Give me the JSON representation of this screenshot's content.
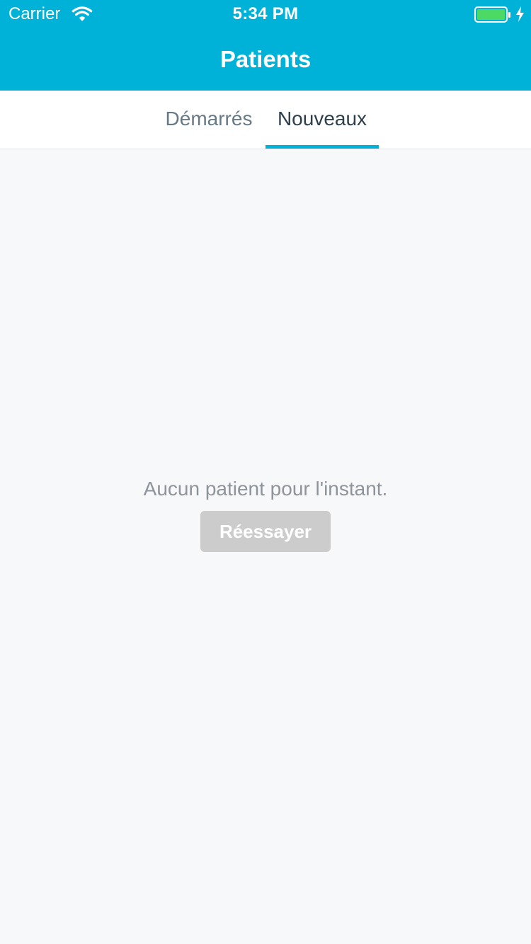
{
  "status_bar": {
    "carrier": "Carrier",
    "time": "5:34 PM",
    "wifi_icon": "wifi-icon",
    "battery_icon": "battery-icon",
    "charging_icon": "charging-bolt-icon"
  },
  "header": {
    "title": "Patients",
    "background_color": "#00b1d8"
  },
  "tabs": [
    {
      "label": "Démarrés",
      "selected": false
    },
    {
      "label": "Nouveaux",
      "selected": true
    }
  ],
  "empty_state": {
    "message": "Aucun patient pour l'instant.",
    "retry_label": "Réessayer"
  },
  "colors": {
    "accent": "#00b1d8",
    "battery_green": "#4cd964",
    "disabled_button": "#cccccc",
    "background": "#f7f8fa"
  }
}
